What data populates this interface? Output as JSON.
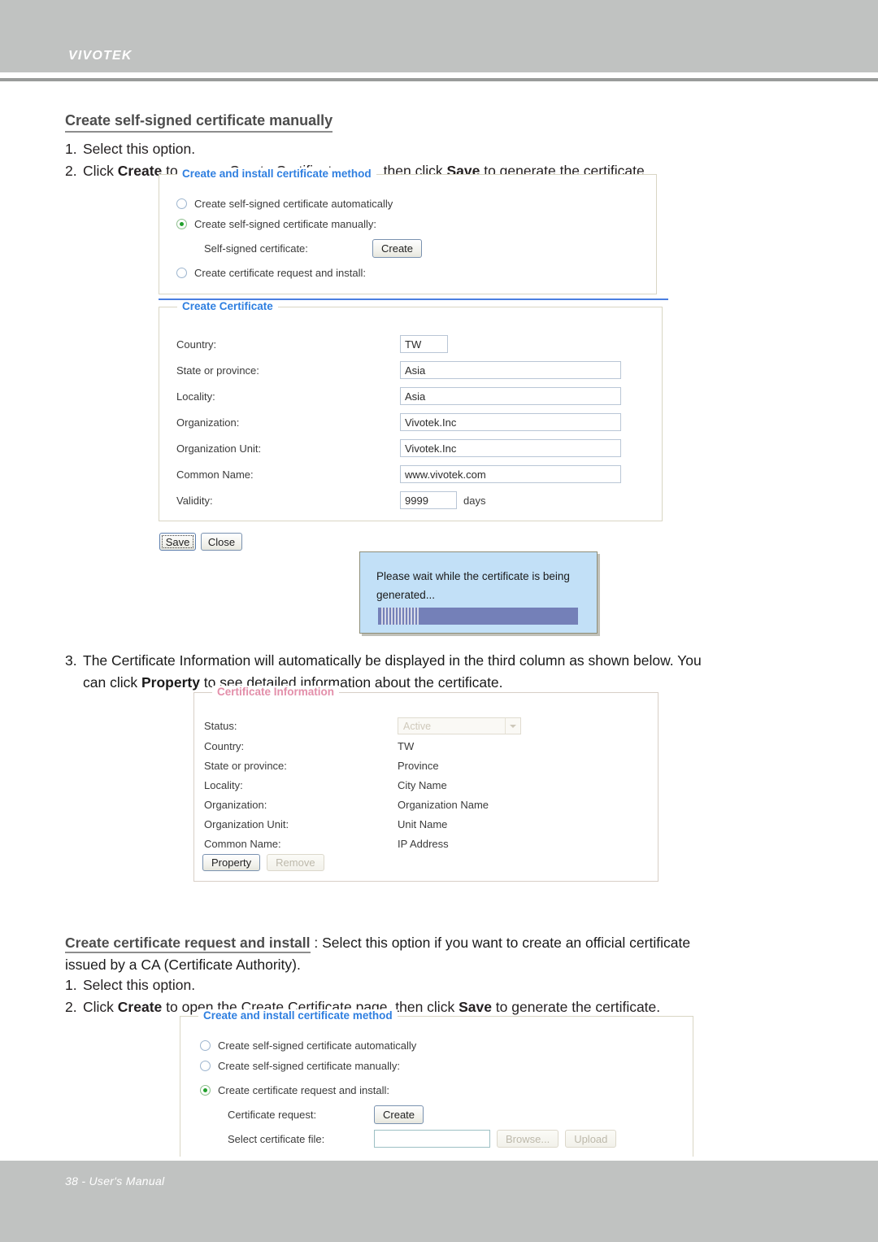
{
  "header": {
    "brand": "VIVOTEK"
  },
  "footer": {
    "page_text": "38 - User's Manual"
  },
  "section1": {
    "heading": "Create self-signed certificate manually",
    "step1_num": "1.",
    "step1_text": "Select this option.",
    "step2_num": "2.",
    "step2_a": "Click ",
    "step2_create": "Create",
    "step2_b": " to open a Create Certificate page, then click ",
    "step2_save": "Save",
    "step2_c": " to generate the certificate."
  },
  "method_panel_1": {
    "legend": "Create and install certificate method",
    "options": [
      {
        "label": "Create self-signed certificate automatically",
        "selected": false
      },
      {
        "label": "Create self-signed certificate manually:",
        "selected": true
      },
      {
        "label": "Create certificate request and install:",
        "selected": false
      }
    ],
    "selfsigned_label": "Self-signed certificate:",
    "create_button": "Create"
  },
  "create_certificate": {
    "legend": "Create Certificate",
    "fields": [
      {
        "label": "Country:",
        "value": "TW"
      },
      {
        "label": "State or province:",
        "value": "Asia"
      },
      {
        "label": "Locality:",
        "value": "Asia"
      },
      {
        "label": "Organization:",
        "value": "Vivotek.Inc"
      },
      {
        "label": "Organization Unit:",
        "value": "Vivotek.Inc"
      },
      {
        "label": "Common Name:",
        "value": "www.vivotek.com"
      },
      {
        "label": "Validity:",
        "value": "9999"
      }
    ],
    "validity_unit": "days",
    "save_button": "Save",
    "close_button": "Close"
  },
  "wait_dialog": {
    "message": "Please wait while the certificate is being generated...",
    "progress_percent": 18
  },
  "section2": {
    "step3_num": "3.",
    "step3_a": "The Certificate Information will automatically be displayed in the third column as shown below. You",
    "step3_b": "can click ",
    "step3_property": "Property",
    "step3_c": " to see detailed information about the certificate."
  },
  "certificate_information": {
    "legend": "Certificate Information",
    "status_label": "Status:",
    "status_value": "Active",
    "rows": [
      {
        "label": "Country:",
        "value": "TW"
      },
      {
        "label": "State or province:",
        "value": "Province"
      },
      {
        "label": "Locality:",
        "value": "City Name"
      },
      {
        "label": "Organization:",
        "value": "Organization Name"
      },
      {
        "label": "Organization Unit:",
        "value": "Unit Name"
      },
      {
        "label": "Common Name:",
        "value": "IP Address"
      }
    ],
    "property_button": "Property",
    "remove_button": "Remove"
  },
  "section3": {
    "lead_heading": "Create certificate request and install",
    "lead_sep": " : ",
    "lead_body_1": "Select this option if you want to create an official certificate",
    "lead_body_2": "issued by a CA (Certificate Authority).",
    "step1_num": "1.",
    "step1_text": "Select this option.",
    "step2_num": "2.",
    "step2_a": "Click ",
    "step2_create": "Create",
    "step2_b": " to open the Create Certificate page, then click ",
    "step2_save": "Save",
    "step2_c": " to generate the certificate."
  },
  "method_panel_2": {
    "legend": "Create and install certificate method",
    "options": [
      {
        "label": "Create self-signed certificate automatically",
        "selected": false
      },
      {
        "label": "Create self-signed certificate manually:",
        "selected": false
      },
      {
        "label": "Create certificate request and install:",
        "selected": true
      }
    ],
    "cert_request_label": "Certificate request:",
    "create_button": "Create",
    "select_file_label": "Select certificate file:",
    "file_value": "",
    "browse_button": "Browse...",
    "upload_button": "Upload"
  }
}
